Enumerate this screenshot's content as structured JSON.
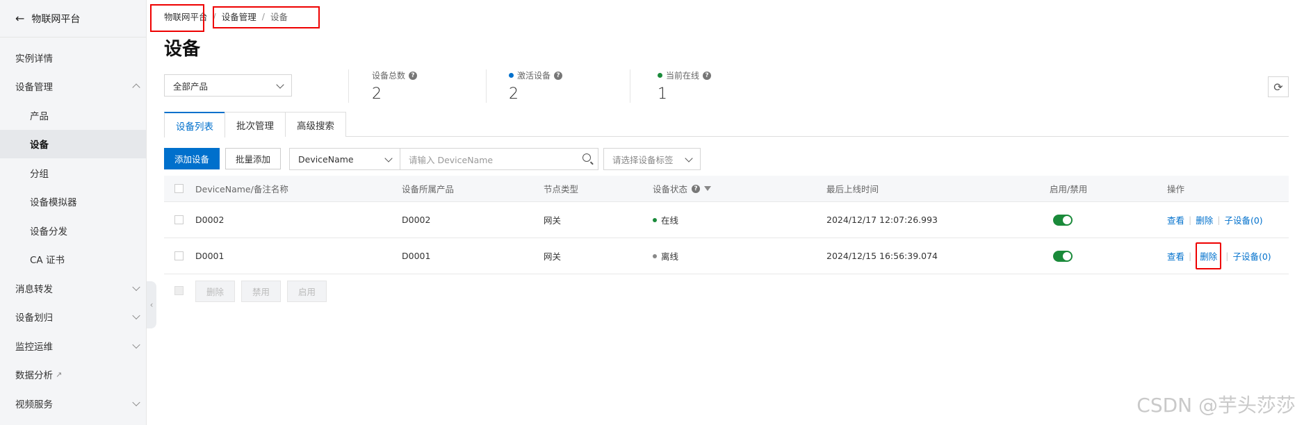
{
  "sidebar": {
    "back_label": "物联网平台",
    "items": [
      {
        "label": "实例详情"
      },
      {
        "label": "设备管理"
      },
      {
        "label": "产品"
      },
      {
        "label": "设备"
      },
      {
        "label": "分组"
      },
      {
        "label": "设备模拟器"
      },
      {
        "label": "设备分发"
      },
      {
        "label": "CA 证书"
      },
      {
        "label": "消息转发"
      },
      {
        "label": "设备划归"
      },
      {
        "label": "监控运维"
      },
      {
        "label": "数据分析"
      },
      {
        "label": "视频服务"
      }
    ]
  },
  "breadcrumb": {
    "root": "物联网平台",
    "level1": "设备管理",
    "sep": "/",
    "level2": "设备"
  },
  "page": {
    "title": "设备"
  },
  "product_select": {
    "value": "全部产品"
  },
  "stats": [
    {
      "label": "设备总数",
      "value": "2"
    },
    {
      "label": "激活设备",
      "value": "2",
      "dot_color": "#0070cc"
    },
    {
      "label": "当前在线",
      "value": "1",
      "dot_color": "#1a8a3a"
    }
  ],
  "tabs": [
    {
      "label": "设备列表"
    },
    {
      "label": "批次管理"
    },
    {
      "label": "高级搜索"
    }
  ],
  "toolbar": {
    "add_label": "添加设备",
    "batch_add_label": "批量添加",
    "field_select": "DeviceName",
    "search_placeholder": "请输入 DeviceName",
    "tag_select": "请选择设备标签"
  },
  "table": {
    "headers": [
      "DeviceName/备注名称",
      "设备所属产品",
      "节点类型",
      "设备状态",
      "最后上线时间",
      "启用/禁用",
      "操作"
    ],
    "rows": [
      {
        "name": "D0002",
        "product": "D0002",
        "node": "网关",
        "status": "在线",
        "status_color": "#1a8a3a",
        "last_online": "2024/12/17 12:07:26.993",
        "ops": [
          "查看",
          "删除",
          "子设备(0)"
        ]
      },
      {
        "name": "D0001",
        "product": "D0001",
        "node": "网关",
        "status": "离线",
        "status_color": "#888888",
        "last_online": "2024/12/15 16:56:39.074",
        "ops": [
          "查看",
          "删除",
          "子设备(0)"
        ]
      }
    ]
  },
  "bulk_actions": [
    "删除",
    "禁用",
    "启用"
  ],
  "watermark": "CSDN @芋头莎莎"
}
